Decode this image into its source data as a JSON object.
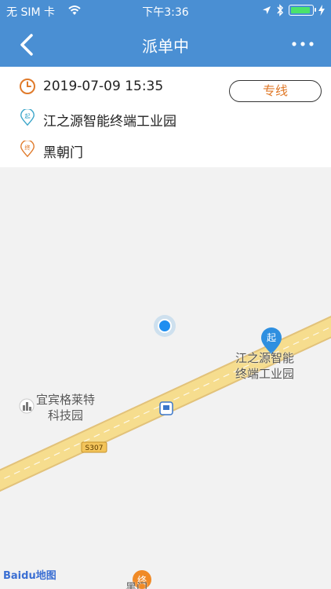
{
  "status_bar": {
    "carrier": "无 SIM 卡",
    "time": "下午3:36",
    "icons": [
      "wifi-icon",
      "location-arrow-icon",
      "bluetooth-icon",
      "battery-icon",
      "charging-icon"
    ]
  },
  "nav": {
    "title": "派单中",
    "back_icon": "chevron-left-icon",
    "more_icon": "more-icon"
  },
  "order": {
    "time": "2019-07-09 15:35",
    "type_tag": "专线",
    "start": "江之源智能终端工业园",
    "end": "黑朝门",
    "start_marker": "起",
    "end_marker": "终"
  },
  "map": {
    "start_label_line1": "江之源智能",
    "start_label_line2": "终端工业园",
    "poi_label_line1": "宜宾格莱特",
    "poi_label_line2": "科技园",
    "road_sign": "S307",
    "partial_label": "黑门",
    "baidu_logo": "Baidu地图"
  },
  "colors": {
    "nav_bg": "#4a8fd3",
    "accent_orange": "#e07a2a",
    "start_marker": "#2e8fe0",
    "road": "#f6dd8e"
  }
}
